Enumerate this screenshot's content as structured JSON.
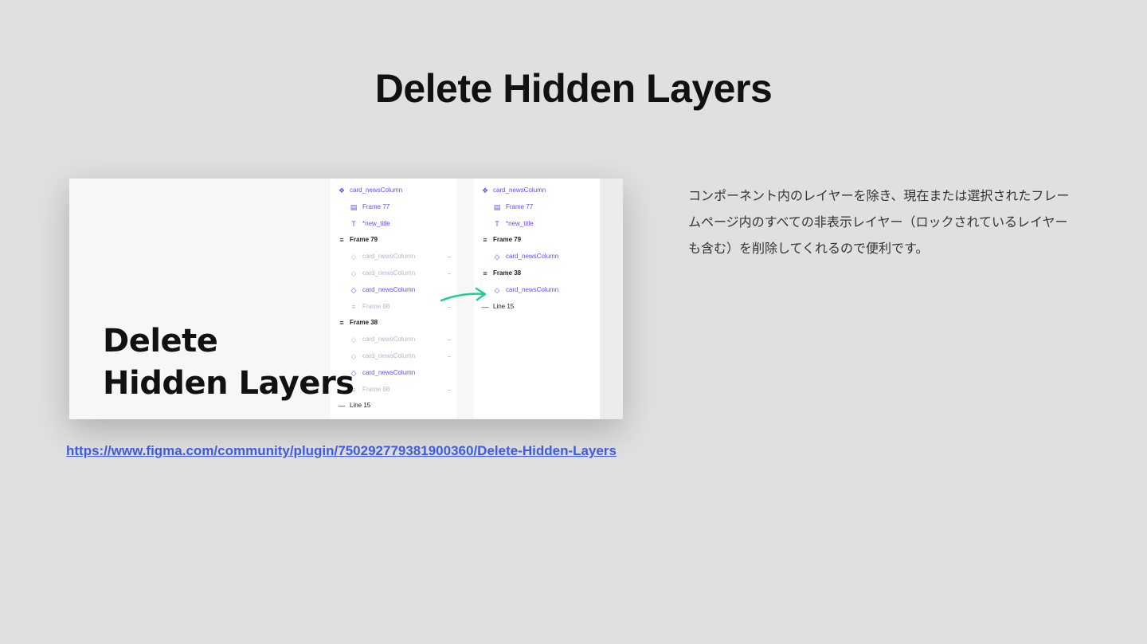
{
  "slide": {
    "title": "Delete Hidden Layers",
    "description": "コンポーネント内のレイヤーを除き、現在または選択されたフレームページ内のすべての非表示レイヤー（ロックされているレイヤーも含む）を削除してくれるので便利です。",
    "url": "https://www.figma.com/community/plugin/750292779381900360/Delete-Hidden-Layers"
  },
  "preview": {
    "headline_line1": "Delete",
    "headline_line2": "Hidden Layers",
    "before_layers": [
      {
        "label": "card_newsColumn",
        "icon": "component-icon",
        "level": 0,
        "state": "main"
      },
      {
        "label": "Frame 77",
        "icon": "frame-icon",
        "level": 1,
        "state": "main"
      },
      {
        "label": "*new_title",
        "icon": "text-icon",
        "level": 1,
        "state": "main"
      },
      {
        "label": "Frame 79",
        "icon": "autolayout-icon",
        "level": 0,
        "state": "dark"
      },
      {
        "label": "card_newsColumn",
        "icon": "instance-icon",
        "level": 1,
        "state": "hidden"
      },
      {
        "label": "card_newsColumn",
        "icon": "instance-icon",
        "level": 1,
        "state": "hidden"
      },
      {
        "label": "card_newsColumn",
        "icon": "instance-icon",
        "level": 1,
        "state": "main"
      },
      {
        "label": "Frame 88",
        "icon": "autolayout-icon",
        "level": 1,
        "state": "hidden"
      },
      {
        "label": "Frame 38",
        "icon": "autolayout-icon",
        "level": 0,
        "state": "dark"
      },
      {
        "label": "card_newsColumn",
        "icon": "instance-icon",
        "level": 1,
        "state": "hidden"
      },
      {
        "label": "card_newsColumn",
        "icon": "instance-icon",
        "level": 1,
        "state": "hidden"
      },
      {
        "label": "card_newsColumn",
        "icon": "instance-icon",
        "level": 1,
        "state": "main"
      },
      {
        "label": "Frame 88",
        "icon": "autolayout-icon",
        "level": 1,
        "state": "hidden"
      },
      {
        "label": "Line 15",
        "icon": "line-icon",
        "level": 0,
        "state": "line"
      }
    ],
    "after_layers": [
      {
        "label": "card_newsColumn",
        "icon": "component-icon",
        "level": 0,
        "state": "main"
      },
      {
        "label": "Frame 77",
        "icon": "frame-icon",
        "level": 1,
        "state": "main"
      },
      {
        "label": "*new_title",
        "icon": "text-icon",
        "level": 1,
        "state": "main"
      },
      {
        "label": "Frame 79",
        "icon": "autolayout-icon",
        "level": 0,
        "state": "dark"
      },
      {
        "label": "card_newsColumn",
        "icon": "instance-icon",
        "level": 1,
        "state": "main"
      },
      {
        "label": "Frame 38",
        "icon": "autolayout-icon",
        "level": 0,
        "state": "dark"
      },
      {
        "label": "card_newsColumn",
        "icon": "instance-icon",
        "level": 1,
        "state": "main"
      },
      {
        "label": "Line 15",
        "icon": "line-icon",
        "level": 0,
        "state": "line"
      }
    ],
    "colors": {
      "main": "#6a4de6",
      "hidden": "#b7b7c9",
      "arrow": "#1fd08a",
      "link": "#3f5bdf"
    }
  }
}
